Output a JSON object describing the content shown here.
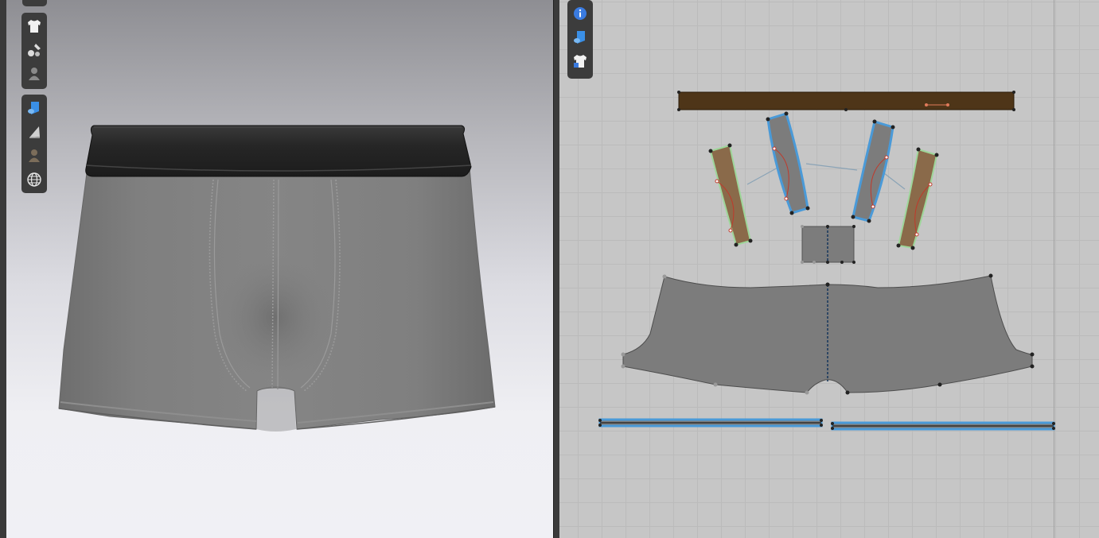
{
  "colors": {
    "toolbar_bg": "#3c3c3c",
    "waistband": "#2a2a2a",
    "fabric_gray": "#7c7c7c",
    "pattern_brown": "#8a6a4a",
    "waistband_pattern": "#4e3518",
    "selection_blue": "#4a9ad8",
    "grid_bg": "#c6c6c6"
  },
  "toolbar_3d": {
    "group_a": [
      {
        "icon": "garment-shirt-icon"
      },
      {
        "icon": "fabric-brush-icon"
      },
      {
        "icon": "avatar-icon"
      }
    ],
    "group_b": [
      {
        "icon": "fabric-roll-icon"
      },
      {
        "icon": "iron-icon"
      },
      {
        "icon": "avatar-skin-icon"
      },
      {
        "icon": "globe-icon"
      }
    ]
  },
  "toolbar_2d": [
    {
      "icon": "info-icon"
    },
    {
      "icon": "fabric-roll-icon"
    },
    {
      "icon": "garment-shirt-lock-icon"
    }
  ],
  "pattern_pieces": [
    {
      "name": "waistband",
      "fill": "brown"
    },
    {
      "name": "front-panel-left-side",
      "fill": "brown"
    },
    {
      "name": "front-panel-left-center",
      "fill": "gray",
      "selected": true
    },
    {
      "name": "front-panel-right-center",
      "fill": "gray",
      "selected": true
    },
    {
      "name": "front-panel-right-side",
      "fill": "brown"
    },
    {
      "name": "gusset",
      "fill": "gray"
    },
    {
      "name": "back-body",
      "fill": "gray"
    },
    {
      "name": "left-leg-binding",
      "fill": "gray",
      "selected": true
    },
    {
      "name": "right-leg-binding",
      "fill": "gray",
      "selected": true
    }
  ]
}
